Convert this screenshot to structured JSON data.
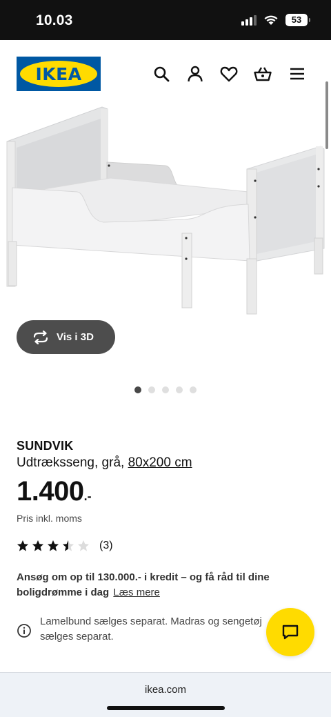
{
  "status_bar": {
    "time": "10.03",
    "battery": "53"
  },
  "header": {
    "logo_text": "IKEA",
    "icons": [
      "search-icon",
      "account-icon",
      "heart-icon",
      "basket-icon",
      "menu-icon"
    ]
  },
  "gallery": {
    "view_3d_label": "Vis i 3D",
    "image_count": 5,
    "active_index": 0
  },
  "product": {
    "name": "SUNDVIK",
    "description": "Udtræksseng, grå, ",
    "size_link": "80x200 cm",
    "price": "1.400",
    "price_suffix": ".-",
    "price_note": "Pris inkl. moms",
    "rating": {
      "value": 3.5,
      "max": 5,
      "count_label": "(3)"
    }
  },
  "credit": {
    "text": "Ansøg om op til 130.000.- i kredit – og få råd til dine boligdrømme i dag",
    "link": "Læs mere"
  },
  "notice": {
    "text": "Lamelbund sælges separat. Madras og sengetøj sælges separat."
  },
  "browser": {
    "url": "ikea.com"
  },
  "colors": {
    "brand_blue": "#0058a3",
    "brand_yellow": "#ffdb00",
    "button_dark": "#4d4d4d"
  }
}
